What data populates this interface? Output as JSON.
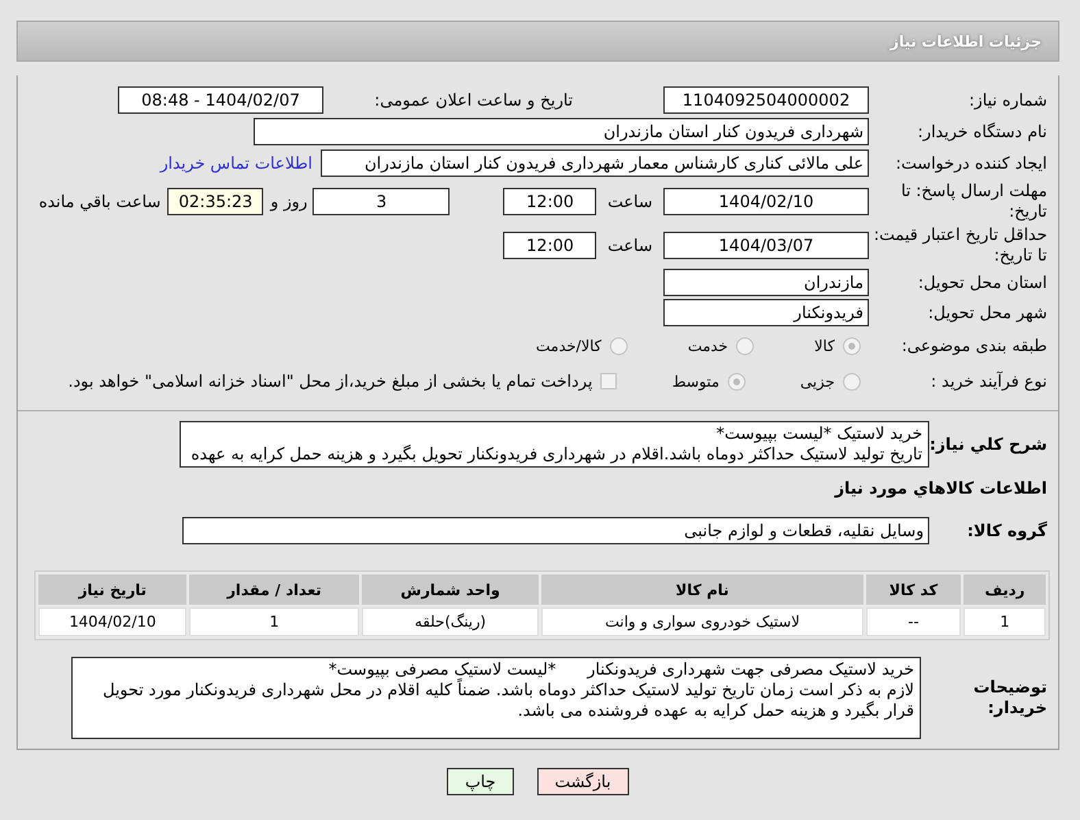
{
  "header": {
    "title": "جزئیات اطلاعات نیاز"
  },
  "need_number": {
    "label": "شماره نیاز:",
    "value": "1104092504000002"
  },
  "announce": {
    "label": "تاریخ و ساعت اعلان عمومی:",
    "value": "1404/02/07 - 08:48"
  },
  "buyer_org": {
    "label": "نام دستگاه خریدار:",
    "value": "شهرداری فریدون کنار استان مازندران"
  },
  "requester": {
    "label": "ایجاد کننده درخواست:",
    "value": "علی مالائی کناری کارشناس معمار شهرداری فریدون کنار استان مازندران",
    "link": "اطلاعات تماس خریدار"
  },
  "reply_deadline": {
    "label": "مهلت ارسال پاسخ: تا تاریخ:",
    "date": "1404/02/10",
    "time_label": "ساعت",
    "time": "12:00",
    "days": "3",
    "days_label": "روز و",
    "remaining": "02:35:23",
    "remaining_label": "ساعت باقي مانده"
  },
  "price_validity": {
    "label": "حداقل تاریخ اعتبار قیمت: تا تاریخ:",
    "date": "1404/03/07",
    "time_label": "ساعت",
    "time": "12:00"
  },
  "province": {
    "label": "استان محل تحویل:",
    "value": "مازندران"
  },
  "city": {
    "label": "شهر محل تحویل:",
    "value": "فریدونکنار"
  },
  "category": {
    "label": "طبقه بندی موضوعی:",
    "options": [
      {
        "label": "کالا",
        "selected": true
      },
      {
        "label": "خدمت",
        "selected": false
      },
      {
        "label": "کالا/خدمت",
        "selected": false
      }
    ]
  },
  "process": {
    "label": "نوع فرآیند خرید :",
    "options": [
      {
        "label": "جزیی",
        "selected": false
      },
      {
        "label": "متوسط",
        "selected": true
      }
    ],
    "treasury": {
      "checked": false,
      "label": "پرداخت تمام یا بخشی از مبلغ خرید،از محل \"اسناد خزانه اسلامی\" خواهد بود."
    }
  },
  "description": {
    "label": "شرح کلي نياز:",
    "lines": [
      "خرید لاستیک *لیست بپیوست*",
      "تاریخ تولید لاستیک حداکثر دوماه باشد.اقلام در شهرداری فریدونکنار تحویل بگیرد و هزینه حمل کرایه به عهده"
    ]
  },
  "goods_title": "اطلاعات کالاهاي مورد نياز",
  "goods_group": {
    "label": "گروه کالا:",
    "value": "وسایل نقلیه، قطعات و لوازم جانبی"
  },
  "table": {
    "columns": [
      "ردیف",
      "کد کالا",
      "نام کالا",
      "واحد شمارش",
      "تعداد / مقدار",
      "تاریخ نیاز"
    ],
    "rows": [
      [
        "1",
        "--",
        "لاستیک خودروی سواری و وانت",
        "(رینگ)حلقه",
        "1",
        "1404/02/10"
      ]
    ]
  },
  "buyer_notes": {
    "label": "توضیحات خریدار:",
    "lines": [
      "خرید لاستیک مصرفی جهت شهرداری فریدونکنار      *لیست لاستیک مصرفی بپیوست*",
      "لازم به ذکر است زمان تاریخ تولید لاستیک حداکثر دوماه باشد. ضمناً کلیه اقلام در محل شهرداری فریدونکنار مورد تحویل قرار بگیرد و هزینه حمل کرایه به عهده فروشنده می باشد."
    ]
  },
  "buttons": [
    {
      "label": "بازگشت",
      "kind": "back"
    },
    {
      "label": "چاپ",
      "kind": "print"
    }
  ]
}
